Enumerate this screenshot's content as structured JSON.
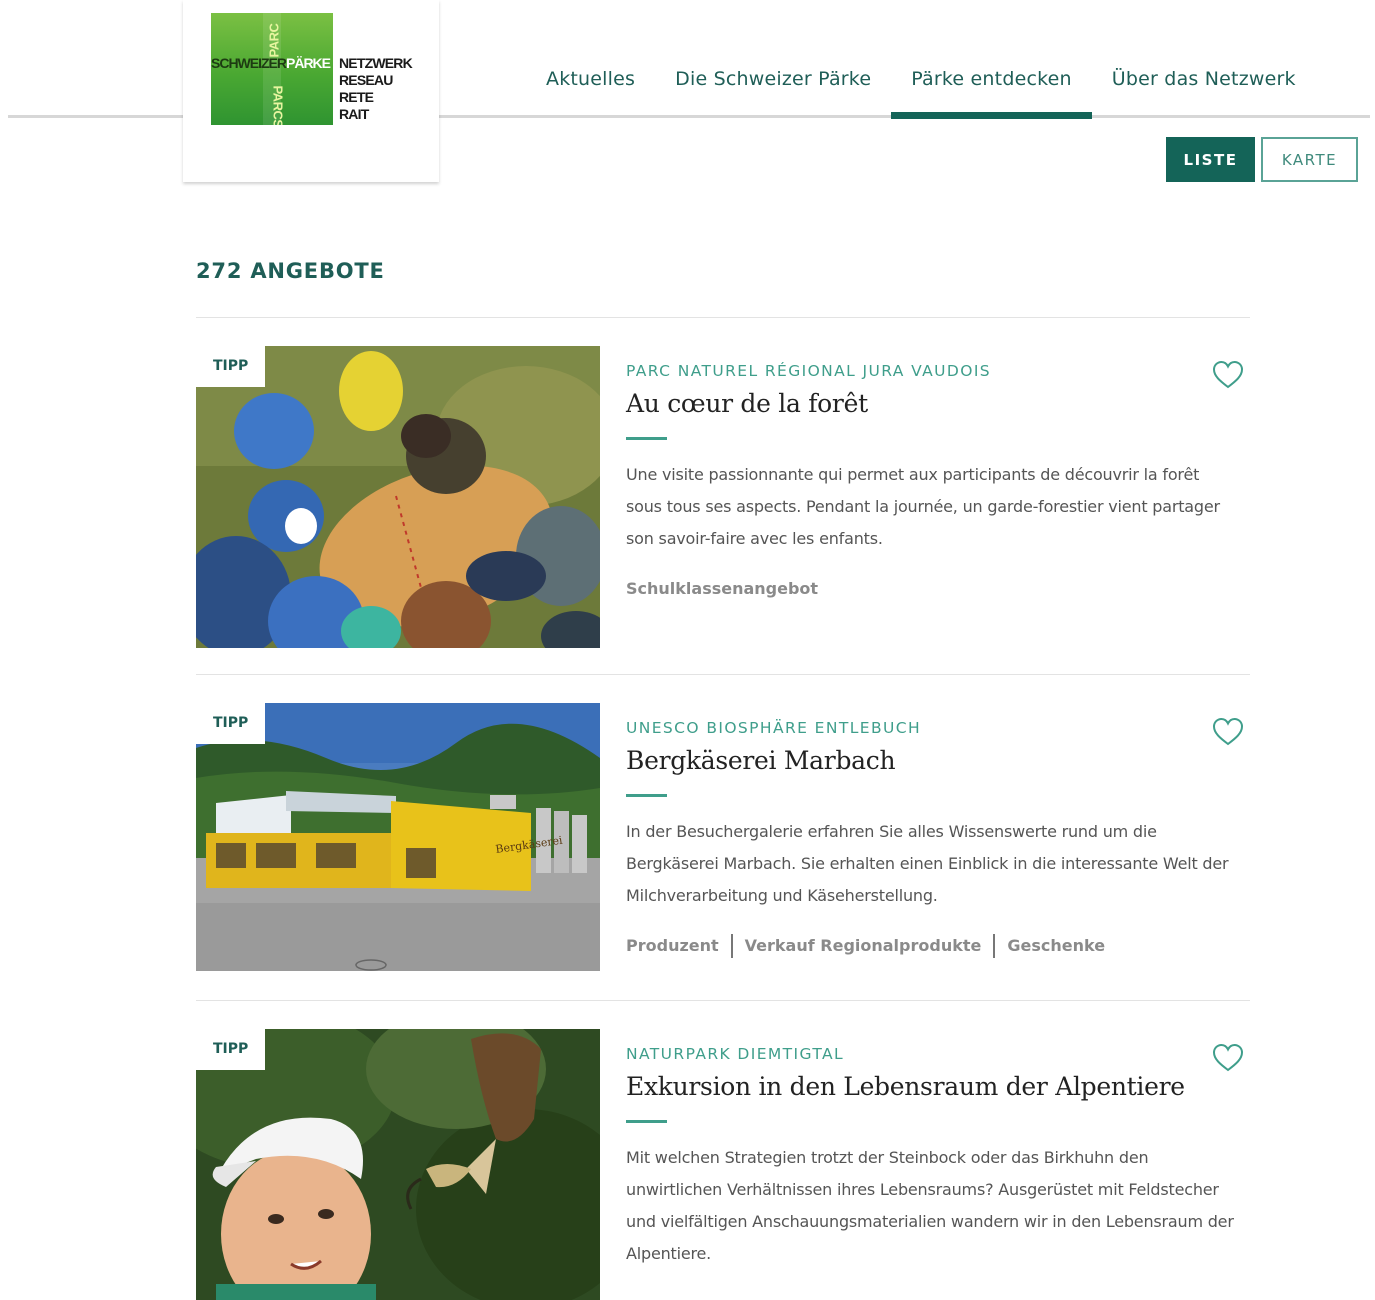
{
  "logo": {
    "vertical_top": "PARC",
    "vertical_bottom": "PARCS",
    "horizontal_a": "SCHWEIZER",
    "horizontal_b": "PÄRKE",
    "words": [
      "NETZWERK",
      "RESEAU",
      "RETE",
      "RAIT"
    ]
  },
  "nav": {
    "items": [
      {
        "label": "Aktuelles",
        "active": false
      },
      {
        "label": "Die Schweizer Pärke",
        "active": false
      },
      {
        "label": "Pärke entdecken",
        "active": true
      },
      {
        "label": "Über das Netzwerk",
        "active": false
      }
    ]
  },
  "view": {
    "list_label": "LISTE",
    "map_label": "KARTE"
  },
  "results": {
    "count_label": "272 ANGEBOTE"
  },
  "offers": [
    {
      "tip": "TIPP",
      "park": "PARC NATUREL RÉGIONAL JURA VAUDOIS",
      "title": "Au cœur de la forêt",
      "description": [
        "Une visite passionnante qui permet aux participants de découvrir la forêt",
        "sous tous ses aspects. Pendant la journée, un garde-forestier vient partager",
        "son savoir-faire avec les enfants."
      ],
      "tags": [
        "Schulklassenangebot"
      ]
    },
    {
      "tip": "TIPP",
      "park": "UNESCO BIOSPHÄRE ENTLEBUCH",
      "title": "Bergkäserei Marbach",
      "description": [
        "In der Besuchergalerie erfahren Sie alles Wissenswerte rund um die",
        "Bergkäserei Marbach. Sie erhalten einen Einblick in die interessante Welt der",
        "Milchverarbeitung und Käseherstellung."
      ],
      "tags": [
        "Produzent",
        "Verkauf Regionalprodukte",
        "Geschenke"
      ],
      "sign": "Bergkäserei"
    },
    {
      "tip": "TIPP",
      "park": "NATURPARK DIEMTIGTAL",
      "title": "Exkursion in den Lebensraum der Alpentiere",
      "description": [
        "Mit welchen Strategien trotzt der Steinbock oder das Birkhuhn den",
        "unwirtlichen Verhältnissen ihres Lebensraums? Ausgerüstet mit Feldstecher",
        "und vielfältigen Anschauungsmaterialien wandern wir in den Lebensraum der",
        "Alpentiere."
      ],
      "tags": []
    }
  ],
  "colors": {
    "accent": "#146458",
    "park_label": "#3f9e8b"
  },
  "icons": {
    "favorite": "heart-outline-icon"
  }
}
